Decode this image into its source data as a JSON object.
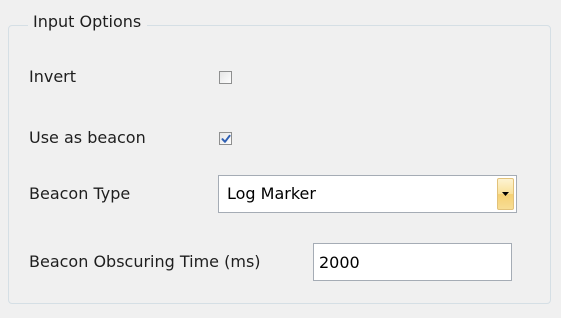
{
  "group": {
    "title": "Input Options"
  },
  "fields": {
    "invert": {
      "label": "Invert",
      "checked": false
    },
    "use_as_beacon": {
      "label": "Use as beacon",
      "checked": true
    },
    "beacon_type": {
      "label": "Beacon Type",
      "value": "Log Marker"
    },
    "beacon_obscuring_time": {
      "label": "Beacon Obscuring Time (ms)",
      "value": "2000"
    }
  },
  "icons": {
    "checkmark": "checkmark-icon",
    "dropdown": "chevron-down-icon"
  },
  "colors": {
    "background": "#f0f0f0",
    "check": "#2f5fb3",
    "dropdown_button": "#f9e19a"
  }
}
